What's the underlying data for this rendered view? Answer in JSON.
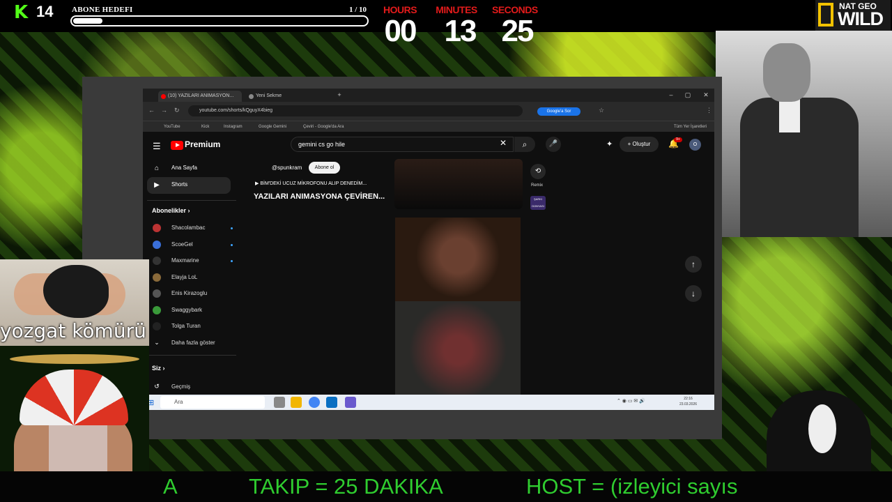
{
  "overlay": {
    "kick_count": "14",
    "goal_label": "ABONE HEDEFI",
    "goal_count": "1 / 10",
    "goal_progress": 0.1,
    "timer": [
      {
        "label": "HOURS",
        "value": "00"
      },
      {
        "label": "MINUTES",
        "value": "13"
      },
      {
        "label": "SECONDS",
        "value": "25"
      }
    ],
    "natgeo_line1": "NAT GEO",
    "natgeo_line2": "WILD",
    "webcam_caption": "yozgat kömürü",
    "ticker": [
      "A",
      "TAKIP = 25 DAKIKA",
      "HOST = (izleyici sayıs"
    ],
    "colors": {
      "kick_green": "#53fc18",
      "timer_red": "#e21b1b",
      "ticker_green": "#2fcc2f"
    }
  },
  "browser": {
    "tabs": [
      "(10) YAZILARI ANIMASYON...",
      "Yeni Sekme"
    ],
    "url": "youtube.com/shorts/kQguyX4bieg",
    "google_search_btn": "Google'a Sor",
    "bookmarks": [
      "YouTube",
      "Kick",
      "Instagram",
      "Google Gemini",
      "Çeviri - Google'da Ara"
    ],
    "all_bookmarks": "Tüm Yer İşaretleri"
  },
  "youtube": {
    "logo_text": "Premium",
    "search_value": "gemini cs go hile",
    "create_label": "Oluştur",
    "notif_badge": "9+",
    "avatar_letter": "O",
    "nav": [
      {
        "label": "Ana Sayfa",
        "icon": "home-icon"
      },
      {
        "label": "Shorts",
        "icon": "shorts-icon"
      }
    ],
    "subscriptions_header": "Abonelikler",
    "subscriptions": [
      "Shacolambac",
      "ScoeGel",
      "Maxmarine",
      "Elayja LoL",
      "Enis Kirazoglu",
      "Swaggybark",
      "Tolga Turan"
    ],
    "show_more": "Daha fazla göster",
    "you_header": "Siz",
    "history": "Geçmiş",
    "short": {
      "channel": "@spunkram",
      "subscribe": "Abone ol",
      "meta": "BİM'DEKİ UCUZ MİKROFONU ALIP DENEDİM...",
      "title": "YAZILARI ANIMASYONA ÇEVİREN..."
    },
    "remix_label": "Remix",
    "song_label": "ŞARKI DÜNYASI"
  },
  "taskbar": {
    "search_placeholder": "Ara",
    "time": "22:16",
    "date": "23.03.2026"
  }
}
